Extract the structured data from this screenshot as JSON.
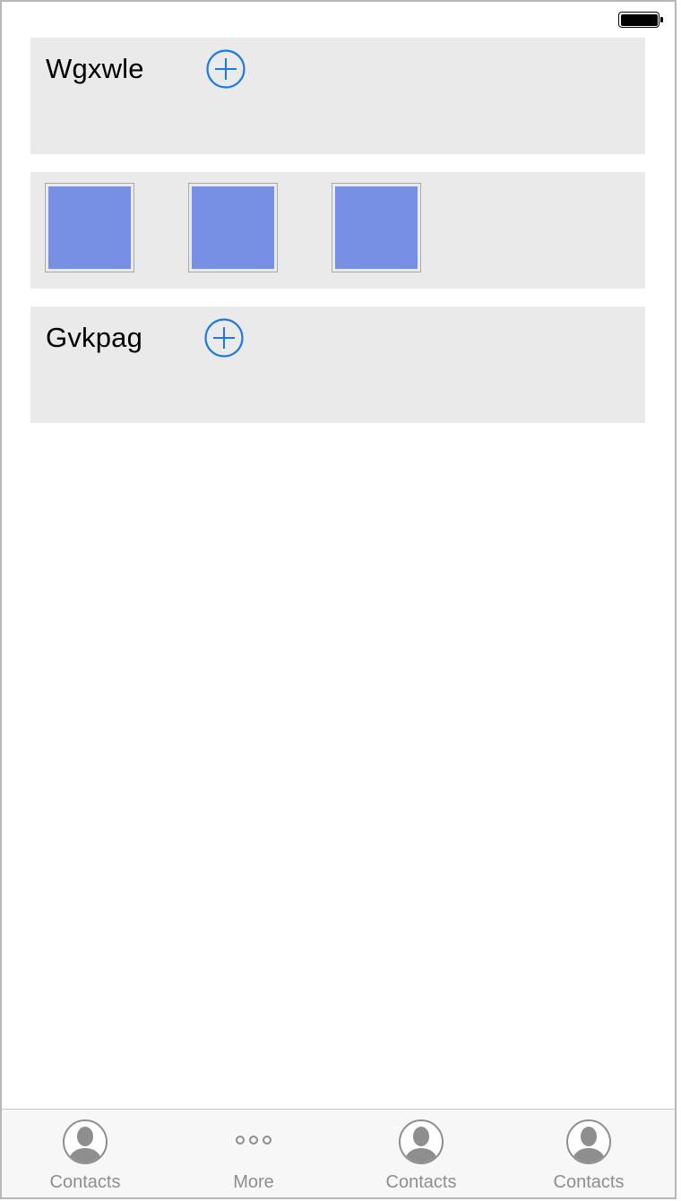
{
  "colors": {
    "accent": "#1a78e6",
    "panel_bg": "#eaeaea",
    "thumb_fill": "#7790e4",
    "tab_text": "#8e8e8e"
  },
  "status_bar": {
    "battery_icon": "battery-full-icon"
  },
  "sections": {
    "first": {
      "title": "Wgxwle",
      "add_icon": "add-circle-icon"
    },
    "gallery": {
      "thumbnails": [
        "image",
        "image",
        "image"
      ]
    },
    "second": {
      "title": "Gvkpag",
      "add_icon": "add-circle-icon"
    }
  },
  "tab_bar": {
    "items": [
      {
        "label": "Contacts",
        "icon": "contact-icon"
      },
      {
        "label": "More",
        "icon": "more-icon"
      },
      {
        "label": "Contacts",
        "icon": "contact-icon"
      },
      {
        "label": "Contacts",
        "icon": "contact-icon"
      }
    ]
  }
}
